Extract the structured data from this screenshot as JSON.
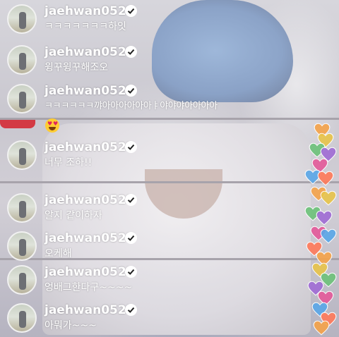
{
  "comments": [
    {
      "username": "jaehwan0527",
      "message": "ㅋㅋㅋㅋㅋㅋㅋ하잇"
    },
    {
      "username": "jaehwan0527",
      "message": "윙꾸윙꾸해조오"
    },
    {
      "username": "jaehwan0527",
      "message": "ㅋㅋㅋㅋㅋㅋ꺄아아아아아아ㅑ야야야아아아아"
    },
    {
      "username": "jaehwan0527",
      "message": "너무 조하!!"
    },
    {
      "username": "jaehwan0527",
      "message": "알지 같이하자"
    },
    {
      "username": "jaehwan0527",
      "message": "오케해"
    },
    {
      "username": "jaehwan0527",
      "message": "엉배그한다구~~~~"
    },
    {
      "username": "jaehwan0527",
      "message": "아뭐가~~~"
    }
  ],
  "reaction_emoji": "heart-eyes",
  "colors": {
    "text": "#ffffff",
    "verified_badge": "#ffffff",
    "hearts": [
      "#f5a34a",
      "#e8c44a",
      "#6dc27a",
      "#a06cd5",
      "#e45a9a",
      "#5aa7e8",
      "#ff7a5a"
    ]
  }
}
